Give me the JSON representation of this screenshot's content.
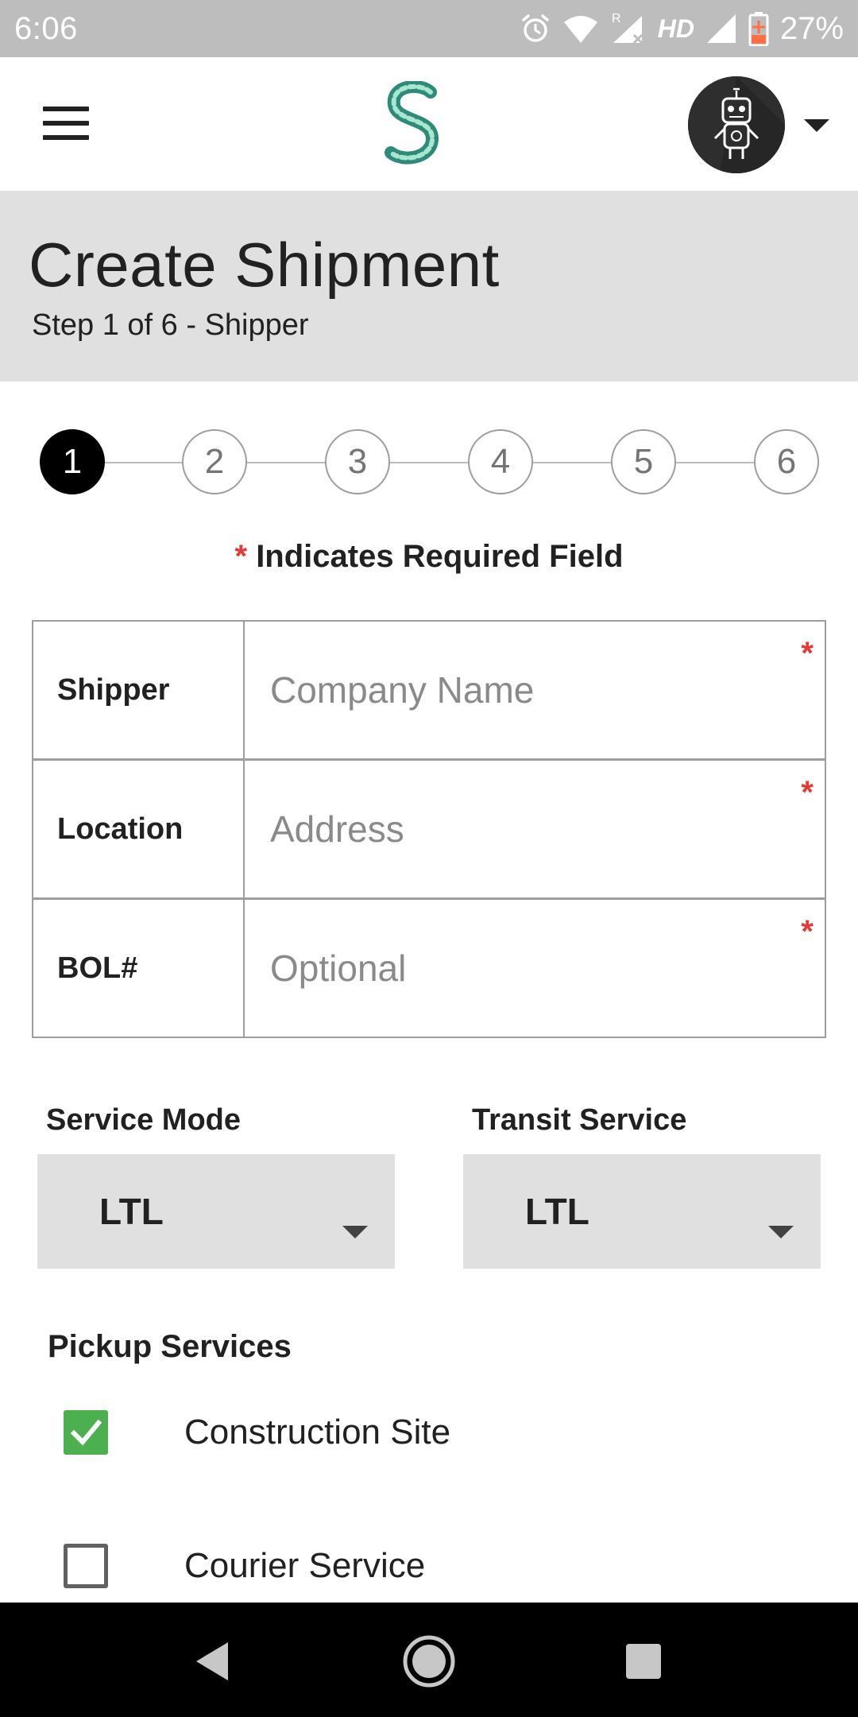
{
  "status_bar": {
    "time": "6:06",
    "network_label": "HD",
    "roaming_label": "R",
    "battery_percent": "27%",
    "icons": [
      "alarm-icon",
      "wifi-icon",
      "signal-roaming-icon",
      "signal-icon",
      "battery-charging-icon"
    ]
  },
  "app_bar": {
    "menu_icon": "hamburger-menu-icon",
    "logo_icon": "s-logo-icon",
    "avatar_icon": "robot-avatar-icon",
    "account_caret_icon": "caret-down-icon"
  },
  "header": {
    "title": "Create Shipment",
    "subtitle": "Step 1 of 6 - Shipper"
  },
  "stepper": {
    "current": 1,
    "steps": [
      "1",
      "2",
      "3",
      "4",
      "5",
      "6"
    ]
  },
  "required_note": {
    "star": "*",
    "text": "Indicates Required Field"
  },
  "form": {
    "rows": [
      {
        "label": "Shipper",
        "placeholder": "Company Name",
        "value": "",
        "required_mark": "*"
      },
      {
        "label": "Location",
        "placeholder": "Address",
        "value": "",
        "required_mark": "*"
      },
      {
        "label": "BOL#",
        "placeholder": "Optional",
        "value": "",
        "required_mark": "*"
      }
    ]
  },
  "service_mode": {
    "label": "Service Mode",
    "value": "LTL"
  },
  "transit_service": {
    "label": "Transit Service",
    "value": "LTL"
  },
  "pickup_services": {
    "label": "Pickup Services",
    "options": [
      {
        "label": "Construction Site",
        "checked": true
      },
      {
        "label": "Courier Service",
        "checked": false
      }
    ]
  },
  "colors": {
    "required_star": "#e53935",
    "checkbox_checked": "#4caf50",
    "header_bg": "#e0e0e0",
    "status_bar_bg": "#bdbdbd",
    "active_step": "#000000",
    "battery_accent": "#ff7043"
  },
  "nav_bar": {
    "icons": [
      "back-icon",
      "home-icon",
      "recents-icon"
    ]
  }
}
